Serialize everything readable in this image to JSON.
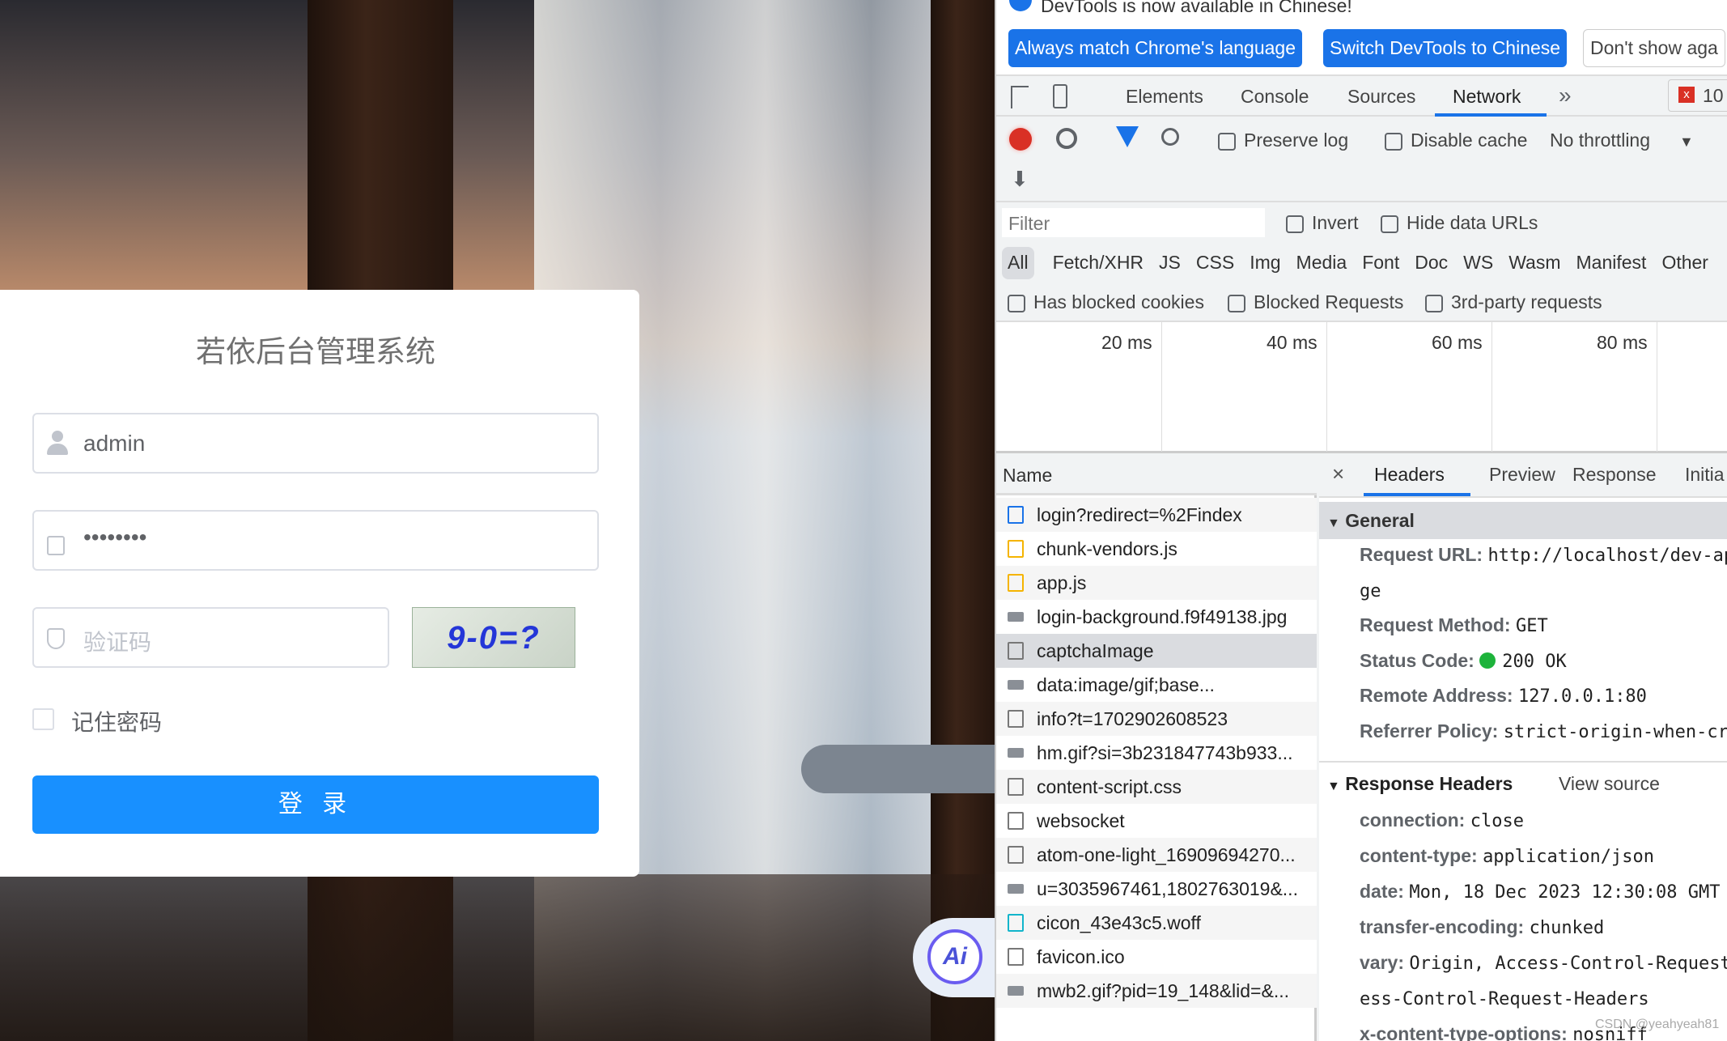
{
  "login": {
    "title": "若依后台管理系统",
    "username": "admin",
    "password": "••••••••",
    "captcha_placeholder": "验证码",
    "captcha_text": "9-0=?",
    "remember": "记住密码",
    "submit": "登 录",
    "ai_label": "Ai"
  },
  "devtools": {
    "infobar": {
      "message": "DevTools is now available in Chinese!",
      "btn_match": "Always match Chrome's language",
      "btn_switch": "Switch DevTools to Chinese",
      "btn_dont": "Don't show aga"
    },
    "tabs": [
      "Elements",
      "Console",
      "Sources",
      "Network"
    ],
    "active_tab": "Network",
    "more": "»",
    "error_count": "10",
    "toolbar": {
      "preserve_log": "Preserve log",
      "disable_cache": "Disable cache",
      "throttling": "No throttling"
    },
    "filter": {
      "placeholder": "Filter",
      "invert": "Invert",
      "hide_data_urls": "Hide data URLs"
    },
    "types": [
      "All",
      "Fetch/XHR",
      "JS",
      "CSS",
      "Img",
      "Media",
      "Font",
      "Doc",
      "WS",
      "Wasm",
      "Manifest",
      "Other"
    ],
    "checks": {
      "blocked_cookies": "Has blocked cookies",
      "blocked_requests": "Blocked Requests",
      "third_party": "3rd-party requests"
    },
    "timeline": [
      "20 ms",
      "40 ms",
      "60 ms",
      "80 ms"
    ],
    "name_header": "Name",
    "requests": [
      {
        "name": "login?redirect=%2Findex",
        "icon": "document-icon"
      },
      {
        "name": "chunk-vendors.js",
        "icon": "script-icon"
      },
      {
        "name": "app.js",
        "icon": "script-icon"
      },
      {
        "name": "login-background.f9f49138.jpg",
        "icon": "image-icon"
      },
      {
        "name": "captchaImage",
        "icon": "file-icon"
      },
      {
        "name": "data:image/gif;base...",
        "icon": "image-icon"
      },
      {
        "name": "info?t=1702902608523",
        "icon": "file-icon"
      },
      {
        "name": "hm.gif?si=3b231847743b933...",
        "icon": "image-icon"
      },
      {
        "name": "content-script.css",
        "icon": "file-icon"
      },
      {
        "name": "websocket",
        "icon": "file-icon"
      },
      {
        "name": "atom-one-light_16909694270...",
        "icon": "file-icon"
      },
      {
        "name": "u=3035967461,1802763019&...",
        "icon": "image-icon"
      },
      {
        "name": "cicon_43e43c5.woff",
        "icon": "font-icon"
      },
      {
        "name": "favicon.ico",
        "icon": "file-icon"
      },
      {
        "name": "mwb2.gif?pid=19_148&lid=&...",
        "icon": "image-icon"
      }
    ],
    "detail_tabs": [
      "Headers",
      "Preview",
      "Response",
      "Initia"
    ],
    "general": {
      "title": "General",
      "rows": [
        {
          "k": "Request URL:",
          "v": "http://localhost/dev-ap"
        },
        {
          "k": "",
          "v": "ge"
        },
        {
          "k": "Request Method:",
          "v": "GET"
        },
        {
          "k": "Status Code:",
          "v": "200 OK"
        },
        {
          "k": "Remote Address:",
          "v": "127.0.0.1:80"
        },
        {
          "k": "Referrer Policy:",
          "v": "strict-origin-when-cr"
        }
      ]
    },
    "response_headers": {
      "title": "Response Headers",
      "view_source": "View source",
      "rows": [
        {
          "k": "connection:",
          "v": "close"
        },
        {
          "k": "content-type:",
          "v": "application/json"
        },
        {
          "k": "date:",
          "v": "Mon, 18 Dec 2023 12:30:08 GMT"
        },
        {
          "k": "transfer-encoding:",
          "v": "chunked"
        },
        {
          "k": "vary:",
          "v": "Origin, Access-Control-Request"
        },
        {
          "k": "",
          "v": "ess-Control-Request-Headers"
        },
        {
          "k": "x-content-type-options:",
          "v": "nosniff"
        }
      ]
    },
    "status_color": "#1db33b",
    "accent": "#1a73e8"
  },
  "watermark": "CSDN @yeahyeah81"
}
